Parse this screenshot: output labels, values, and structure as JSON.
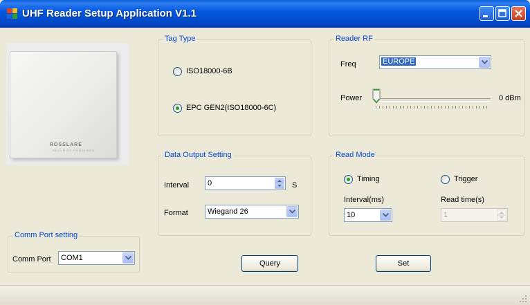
{
  "window": {
    "title": "UHF Reader Setup Application V1.1"
  },
  "device_image": {
    "brand": "ROSSLARE",
    "brand_sub": "SECURITY PRODUCTS"
  },
  "tag_type": {
    "label": "Tag Type",
    "options": [
      {
        "label": "ISO18000-6B",
        "selected": false
      },
      {
        "label": "EPC GEN2(ISO18000-6C)",
        "selected": true
      }
    ]
  },
  "reader_rf": {
    "label": "Reader RF",
    "freq_label": "Freq",
    "freq_value": "EUROPE",
    "power_label": "Power",
    "power_value": "0 dBm",
    "power_level": 0
  },
  "data_output": {
    "label": "Data Output Setting",
    "interval_label": "Interval",
    "interval_value": "0",
    "interval_unit": "S",
    "format_label": "Format",
    "format_value": "Wiegand 26"
  },
  "read_mode": {
    "label": "Read Mode",
    "timing_label": "Timing",
    "timing_selected": true,
    "trigger_label": "Trigger",
    "trigger_selected": false,
    "interval_ms_label": "Interval(ms)",
    "interval_ms_value": "10",
    "read_time_label": "Read time(s)",
    "read_time_value": "1"
  },
  "comm_port": {
    "label": "Comm Port setting",
    "port_label": "Comm Port",
    "port_value": "COM1"
  },
  "buttons": {
    "query": "Query",
    "set": "Set"
  },
  "colors": {
    "titlebar": "#0558e0",
    "group_label": "#0046d5",
    "window_bg": "#ece9d8",
    "radio_dot": "#21a121"
  }
}
